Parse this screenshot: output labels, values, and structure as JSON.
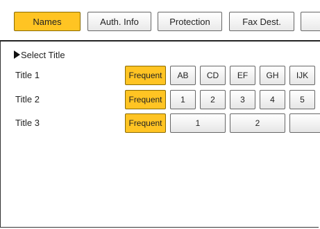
{
  "tabs": [
    {
      "label": "Names",
      "active": true
    },
    {
      "label": "Auth. Info",
      "active": false
    },
    {
      "label": "Protection",
      "active": false
    },
    {
      "label": "Fax Dest.",
      "active": false
    },
    {
      "label": "",
      "active": false
    }
  ],
  "select_title": "Select Title",
  "rows": [
    {
      "label": "Title 1",
      "keys": [
        "Frequent",
        "AB",
        "CD",
        "EF",
        "GH",
        "IJK"
      ]
    },
    {
      "label": "Title 2",
      "keys": [
        "Frequent",
        "1",
        "2",
        "3",
        "4",
        "5"
      ]
    },
    {
      "label": "Title 3",
      "keys": [
        "Frequent",
        "1",
        "2",
        ""
      ]
    }
  ],
  "colors": {
    "accent": "#ffc423"
  }
}
